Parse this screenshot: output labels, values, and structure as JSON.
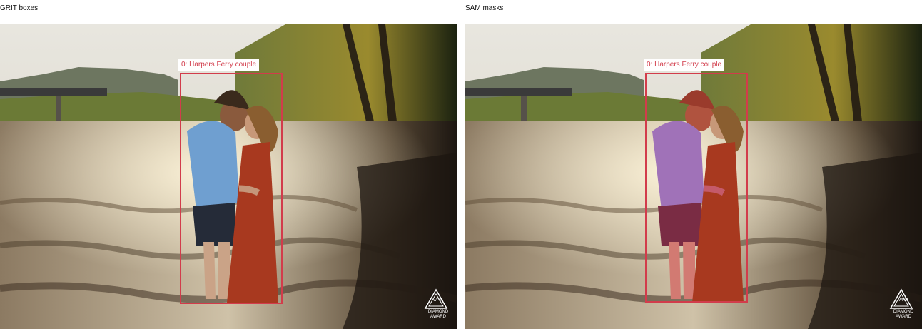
{
  "panels": [
    {
      "title": "GRIT boxes",
      "label": "0: Harpers Ferry couple",
      "mask": false
    },
    {
      "title": "SAM masks",
      "label": "0: Harpers Ferry couple",
      "mask": true
    }
  ],
  "watermark": {
    "badge": "WPJA",
    "line1": "DIAMOND",
    "line2": "AWARD"
  },
  "colors": {
    "box": "#d23c4b",
    "mask": "#b44bd2"
  }
}
